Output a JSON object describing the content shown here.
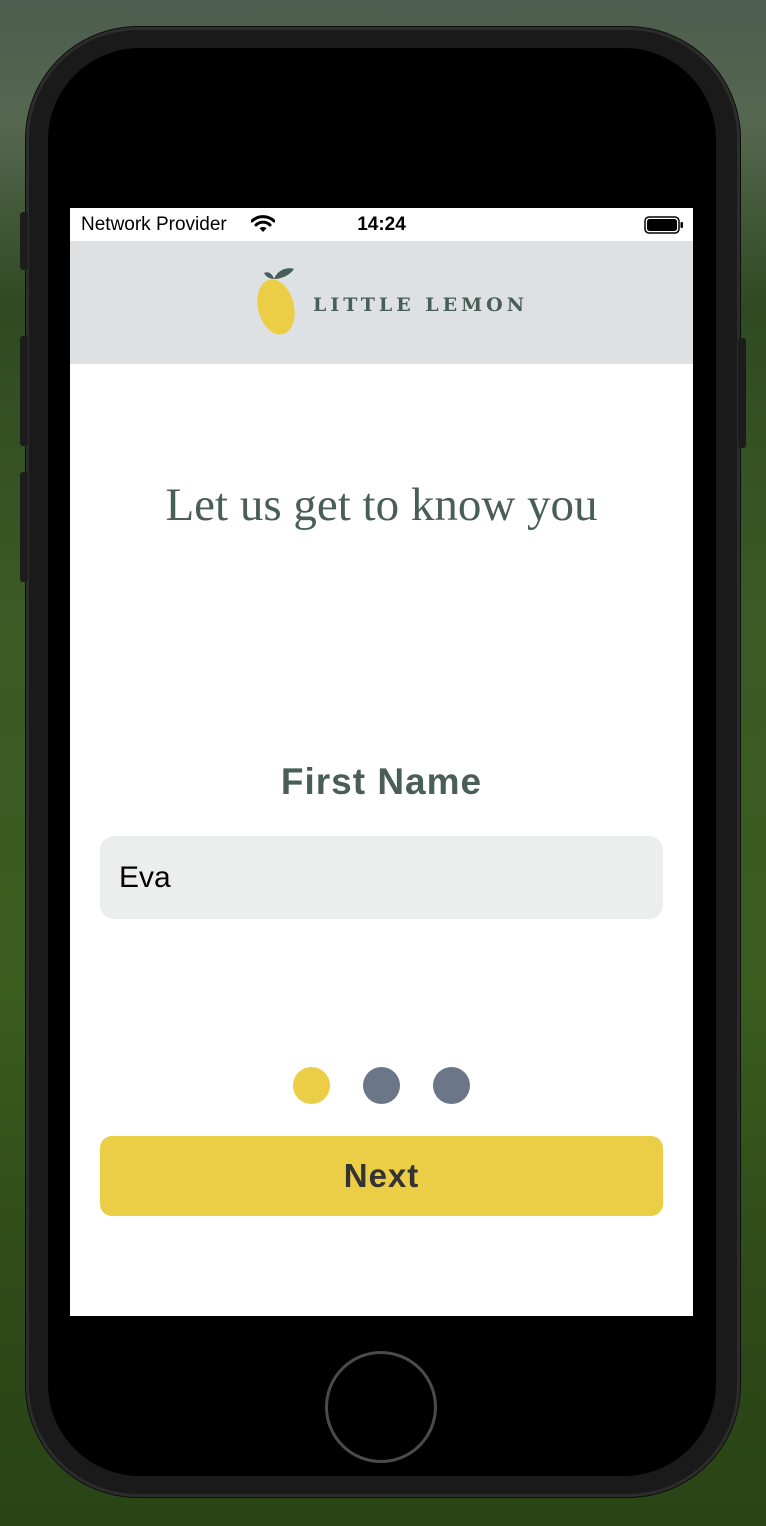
{
  "status_bar": {
    "carrier": "Network Provider",
    "time": "14:24",
    "wifi_icon": "wifi-icon",
    "battery_icon": "battery-full-icon"
  },
  "header": {
    "logo_icon": "lemon-icon",
    "logo_text": "LITTLE LEMON"
  },
  "onboarding": {
    "title": "Let us get to know you",
    "field_label": "First Name",
    "first_name_value": "Eva",
    "pages_total": 3,
    "current_page": 1,
    "next_label": "Next"
  },
  "colors": {
    "header_bg": "#dee1e4",
    "primary_green": "#495e57",
    "accent_yellow": "#eccd46",
    "dot_inactive": "#6c7689",
    "input_bg": "#eceeed"
  }
}
